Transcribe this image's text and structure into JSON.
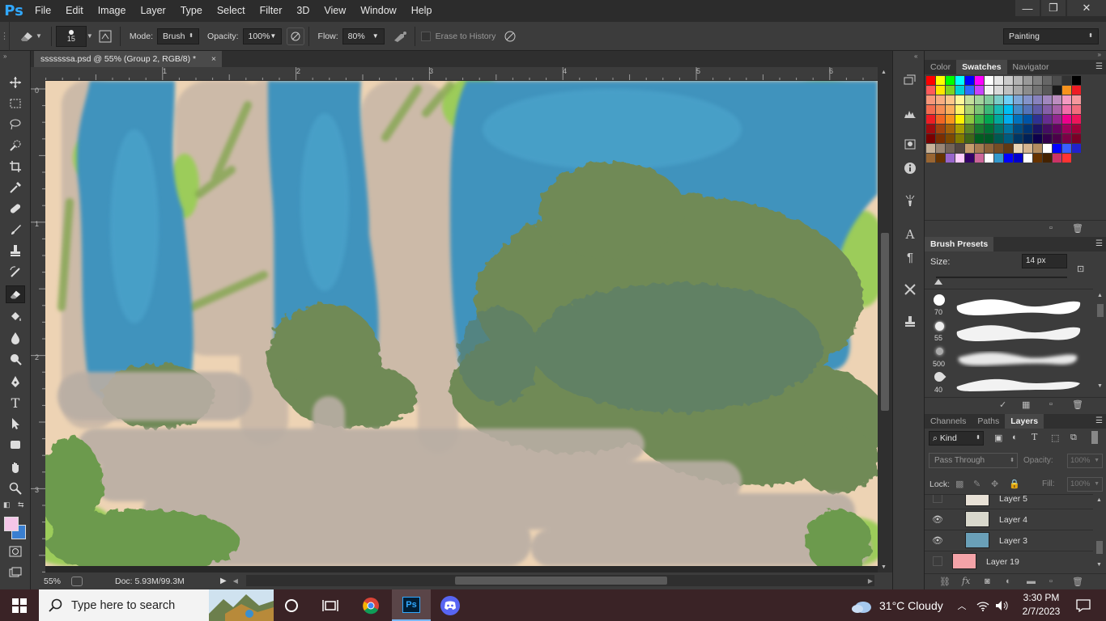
{
  "app": {
    "logo": "Ps"
  },
  "menu": [
    "File",
    "Edit",
    "Image",
    "Layer",
    "Type",
    "Select",
    "Filter",
    "3D",
    "View",
    "Window",
    "Help"
  ],
  "window_controls": {
    "minimize": "—",
    "restore": "❐",
    "close": "✕"
  },
  "options": {
    "brush_size": "15",
    "mode_label": "Mode:",
    "mode_value": "Brush",
    "opacity_label": "Opacity:",
    "opacity_value": "100%",
    "flow_label": "Flow:",
    "flow_value": "80%",
    "erase_history_label": "Erase to History",
    "workspace": "Painting"
  },
  "document": {
    "tab_title": "sssssssa.psd @ 55% (Group 2, RGB/8) *",
    "close_glyph": "×",
    "ruler_h_labels": [
      "1",
      "2",
      "3",
      "4",
      "5",
      "6"
    ],
    "ruler_v_labels": [
      "0",
      "1",
      "2",
      "3"
    ]
  },
  "status": {
    "zoom": "55%",
    "doc": "Doc: 5.93M/99.3M"
  },
  "panels": {
    "color_tabs": [
      "Color",
      "Swatches",
      "Navigator"
    ],
    "brush_presets_title": "Brush Presets",
    "size_label": "Size:",
    "size_value": "14 px",
    "brushes": [
      {
        "size": "70"
      },
      {
        "size": "55"
      },
      {
        "size": "500"
      },
      {
        "size": "40"
      }
    ],
    "layers_tabs": [
      "Channels",
      "Paths",
      "Layers"
    ],
    "kind_label": "Kind",
    "blend_mode": "Pass Through",
    "opacity_label": "Opacity:",
    "opacity_value": "100%",
    "lock_label": "Lock:",
    "fill_label": "Fill:",
    "fill_value": "100%",
    "layers": [
      {
        "name": "Layer 5",
        "visible": false
      },
      {
        "name": "Layer 4",
        "visible": true
      },
      {
        "name": "Layer 3",
        "visible": true
      },
      {
        "name": "Layer 19",
        "visible": false
      }
    ]
  },
  "swatches": [
    "#ff0000",
    "#ffff00",
    "#00ff00",
    "#00ffff",
    "#0000ff",
    "#ff00ff",
    "#ffffff",
    "#e6e6e6",
    "#cccccc",
    "#b3b3b3",
    "#999999",
    "#808080",
    "#666666",
    "#4d4d4d",
    "#333333",
    "#000000",
    "#ff5a5a",
    "#ffe600",
    "#7ed321",
    "#00d2d2",
    "#2c6cff",
    "#c841ff",
    "#f2f2f2",
    "#dadada",
    "#c0c0c0",
    "#a6a6a6",
    "#8c8c8c",
    "#737373",
    "#595959",
    "#1a1a1a",
    "#f7931e",
    "#ed1c24",
    "#f7977a",
    "#f9ad81",
    "#fdc68a",
    "#fff79a",
    "#c4df9b",
    "#a3d39c",
    "#82ca9d",
    "#7bcdc8",
    "#6ecff6",
    "#7ea7d8",
    "#8493ca",
    "#8882be",
    "#a187be",
    "#bc8dbf",
    "#f49ac2",
    "#f6989d",
    "#f26c4f",
    "#f68e55",
    "#fbaf5c",
    "#fff467",
    "#acd372",
    "#7cc576",
    "#3bb878",
    "#1abbb4",
    "#00bff3",
    "#438cca",
    "#5574b9",
    "#605ca8",
    "#855fa8",
    "#a763a8",
    "#f06ea9",
    "#f26d7d",
    "#ed1c24",
    "#f26522",
    "#f7941d",
    "#fff200",
    "#8dc73f",
    "#39b54a",
    "#00a651",
    "#00a99d",
    "#00aeef",
    "#0072bc",
    "#0054a6",
    "#2e3192",
    "#662d91",
    "#92278f",
    "#ec008c",
    "#ed145b",
    "#9e0b0f",
    "#a0410d",
    "#a36209",
    "#aba000",
    "#598527",
    "#1a7b30",
    "#007236",
    "#00746b",
    "#0076a3",
    "#004b80",
    "#003471",
    "#1b1464",
    "#440e62",
    "#630460",
    "#9e005d",
    "#9e0039",
    "#790000",
    "#7b2e00",
    "#7d4900",
    "#827b00",
    "#406618",
    "#005e20",
    "#005826",
    "#005952",
    "#005b7f",
    "#003663",
    "#002157",
    "#0d004c",
    "#32004b",
    "#4b0049",
    "#7b0046",
    "#7a0026",
    "#c7b299",
    "#998675",
    "#736357",
    "#534741",
    "#c69c6d",
    "#a67c52",
    "#8c6239",
    "#754c24",
    "#603913",
    "#e8d5b5",
    "#d4b58f",
    "#b38d60",
    "#ffffff",
    "#0000ff",
    "#3a5fff",
    "#2222cc",
    "#996633",
    "#663300",
    "#9966cc",
    "#ffccff",
    "#330066",
    "#cc6699",
    "#ffffff",
    "#3399cc",
    "#0000ff",
    "#0000cc",
    "#ffffff",
    "#663300",
    "#442200",
    "#cc3366",
    "#ff3333"
  ],
  "taskbar": {
    "search_placeholder": "Type here to search",
    "weather": "31°C  Cloudy",
    "time": "3:30 PM",
    "date": "2/7/2023"
  },
  "colors": {
    "foreground": "#f5c6e8",
    "background": "#3a7fd0",
    "accent": "#31a8ff"
  }
}
